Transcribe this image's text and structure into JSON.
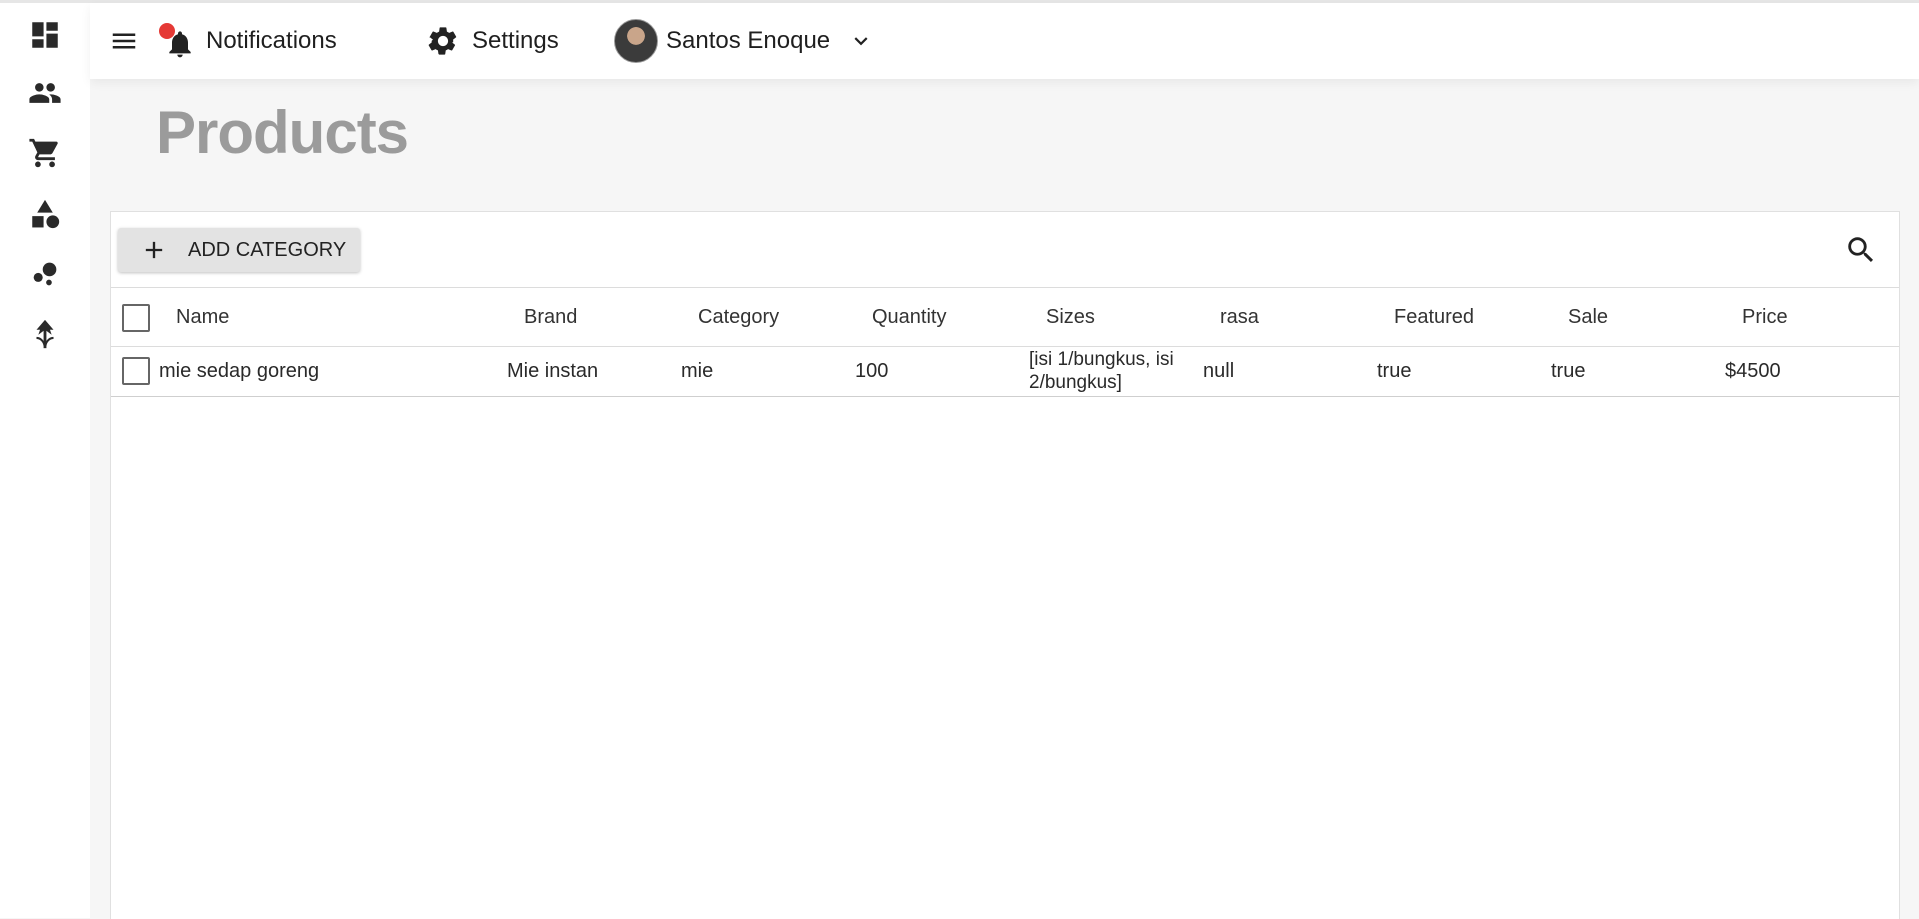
{
  "sidebar": {
    "icons": [
      "dashboard-icon",
      "people-icon",
      "cart-icon",
      "category-shapes-icon",
      "bubble-chart-icon",
      "branch-icon"
    ]
  },
  "topbar": {
    "notifications_label": "Notifications",
    "settings_label": "Settings",
    "user_name": "Santos Enoque",
    "notification_dot_color": "#e53935"
  },
  "page": {
    "title": "Products"
  },
  "toolbar": {
    "add_label": "ADD CATEGORY"
  },
  "table": {
    "columns": [
      "Name",
      "Brand",
      "Category",
      "Quantity",
      "Sizes",
      "rasa",
      "Featured",
      "Sale",
      "Price"
    ],
    "rows": [
      {
        "name": "mie sedap goreng",
        "brand": "Mie instan",
        "category": "mie",
        "quantity": "100",
        "sizes": "[isi 1/bungkus, isi 2/bungkus]",
        "rasa": "null",
        "featured": "true",
        "sale": "true",
        "price": "$4500"
      }
    ]
  }
}
